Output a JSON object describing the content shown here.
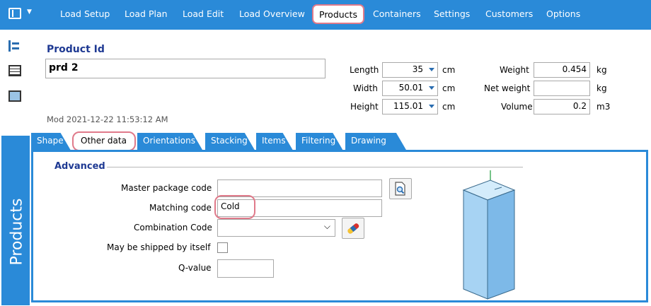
{
  "menu": {
    "items": [
      "Load Setup",
      "Load Plan",
      "Load Edit",
      "Load Overview",
      "Products",
      "Containers",
      "Settings",
      "Customers",
      "Options"
    ],
    "active": "Products",
    "bg_color": "#2a8ad8"
  },
  "sidebar": {
    "label": "Products",
    "icons": [
      "tree-icon",
      "list-icon",
      "picture-icon"
    ]
  },
  "product": {
    "id_label": "Product Id",
    "id_value": "prd 2",
    "modified": "Mod 2021-12-22 11:53:12 AM"
  },
  "dimensions": {
    "length_label": "Length",
    "length_value": "35",
    "length_unit": "cm",
    "width_label": "Width",
    "width_value": "50.01",
    "width_unit": "cm",
    "height_label": "Height",
    "height_value": "115.01",
    "height_unit": "cm"
  },
  "weights": {
    "weight_label": "Weight",
    "weight_value": "0.454",
    "weight_unit": "kg",
    "net_label": "Net weight",
    "net_value": "",
    "net_unit": "kg",
    "volume_label": "Volume",
    "volume_value": "0.2",
    "volume_unit": "m3"
  },
  "tabs": [
    "Shape",
    "Other data",
    "Orientations",
    "Stacking",
    "Items",
    "Filtering",
    "Drawing"
  ],
  "active_tab": "Other data",
  "advanced": {
    "title": "Advanced",
    "master_label": "Master package code",
    "master_value": "",
    "matching_label": "Matching code",
    "matching_value": "Cold",
    "combination_label": "Combination Code",
    "combination_value": "",
    "shipped_label": "May be shipped by itself",
    "shipped_checked": false,
    "qvalue_label": "Q-value",
    "qvalue_value": ""
  },
  "colors": {
    "accent": "#2a8ad8",
    "highlight": "#e07a8a",
    "title": "#1f3a93"
  }
}
